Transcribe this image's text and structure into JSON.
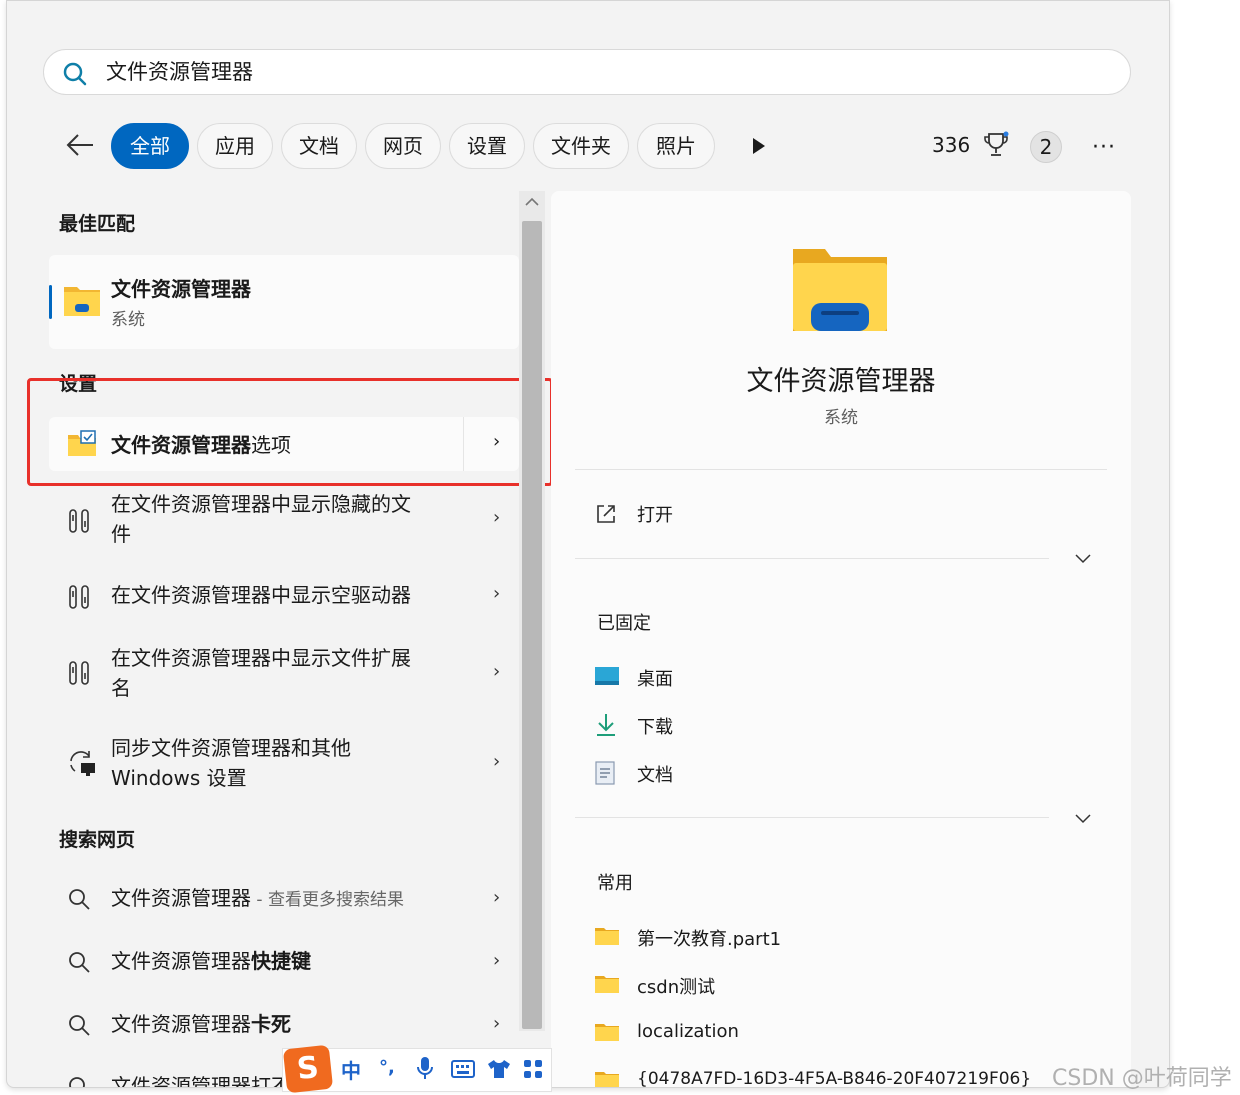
{
  "search": {
    "value": "文件资源管理器"
  },
  "tabs": [
    {
      "label": "全部",
      "active": true
    },
    {
      "label": "应用"
    },
    {
      "label": "文档"
    },
    {
      "label": "网页"
    },
    {
      "label": "设置"
    },
    {
      "label": "文件夹"
    },
    {
      "label": "照片"
    }
  ],
  "header": {
    "points": "336",
    "badge": "2",
    "more": "···"
  },
  "best": {
    "section": "最佳匹配",
    "name": "文件资源管理器",
    "sub": "系统"
  },
  "settings": {
    "section": "设置",
    "option_bold": "文件资源管理器",
    "option_rest": "选项",
    "items": [
      {
        "line1": "在文件资源管理器中显示隐藏的文",
        "line2": "件"
      },
      {
        "line1": "在文件资源管理器中显示空驱动器",
        "line2": ""
      },
      {
        "line1": "在文件资源管理器中显示文件扩展",
        "line2": "名"
      },
      {
        "line1": "同步文件资源管理器和其他",
        "line2": "Windows 设置"
      }
    ]
  },
  "web": {
    "section": "搜索网页",
    "items": [
      {
        "text": "文件资源管理器",
        "bold": "",
        "suffix": " - 查看更多搜索结果"
      },
      {
        "text": "文件资源管理器",
        "bold": "快捷键",
        "suffix": ""
      },
      {
        "text": "文件资源管理器",
        "bold": "卡死",
        "suffix": ""
      },
      {
        "text": "文件资源管理器打不",
        "bold": "",
        "suffix": ""
      }
    ]
  },
  "detail": {
    "title": "文件资源管理器",
    "sub": "系统",
    "open": "打开",
    "pinned_label": "已固定",
    "pinned": [
      "桌面",
      "下载",
      "文档"
    ],
    "recent_label": "常用",
    "recent": [
      "第一次教育.part1",
      "csdn测试",
      "localization",
      "{0478A7FD-16D3-4F5A-B846-20F407219F06}"
    ]
  },
  "ime": {
    "lang": "中",
    "punct": "°,",
    "logo": "S"
  },
  "watermark": "CSDN @叶荷同学",
  "colors": {
    "accent": "#0067c0",
    "highlight": "#e8302a"
  }
}
